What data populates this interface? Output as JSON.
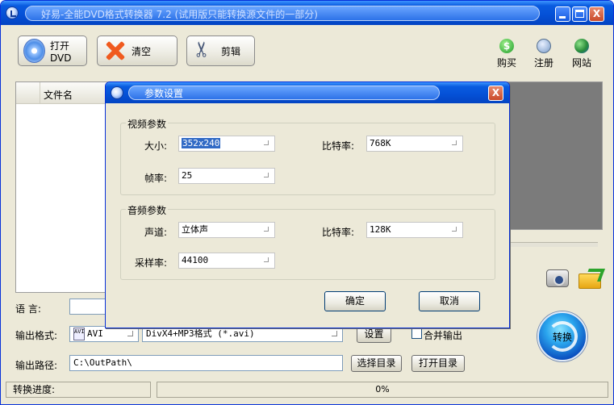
{
  "window": {
    "title": "好易-全能DVD格式转换器 7.2 (试用版只能转换源文件的一部分)",
    "min_label": "_",
    "max_label": "",
    "close_label": "X"
  },
  "toolbar": {
    "open_dvd_label": "打开DVD",
    "clear_label": "清空",
    "cut_label": "剪辑",
    "buy_label": "购买",
    "buy_icon_glyph": "$",
    "register_label": "注册",
    "website_label": "网站"
  },
  "file_list": {
    "column_header": "文件名"
  },
  "form": {
    "language_label": "语    言:",
    "language_value": "",
    "output_format_label": "输出格式:",
    "format_type_value": "AVI",
    "format_icon_text": "AVI",
    "format_detail_value": "DivX4+MP3格式 (*.avi)",
    "settings_button": "设置",
    "merge_output_label": "合并输出",
    "output_path_label": "输出路径:",
    "output_path_value": "C:\\OutPath\\",
    "choose_dir_button": "选择目录",
    "open_dir_button": "打开目录",
    "convert_button": "转换"
  },
  "status": {
    "progress_label": "转换进度:",
    "progress_value": "0%"
  },
  "dialog": {
    "title": "参数设置",
    "close_label": "X",
    "video_group_title": "视频参数",
    "size_label": "大小:",
    "size_value": "352x240",
    "video_bitrate_label": "比特率:",
    "video_bitrate_value": "768K",
    "framerate_label": "帧率:",
    "framerate_value": "25",
    "audio_group_title": "音频参数",
    "channel_label": "声道:",
    "channel_value": "立体声",
    "audio_bitrate_label": "比特率:",
    "audio_bitrate_value": "128K",
    "samplerate_label": "采样率:",
    "samplerate_value": "44100",
    "ok_button": "确定",
    "cancel_button": "取消"
  },
  "icons": {
    "app": "app-icon",
    "dvd": "dvd-disc-icon",
    "clear": "red-x-icon",
    "cut": "scissors-icon",
    "buy": "dollar-icon",
    "register": "lock-icon",
    "website": "globe-icon",
    "snapshot": "camera-icon",
    "open_output": "folder-arrow-icon"
  }
}
